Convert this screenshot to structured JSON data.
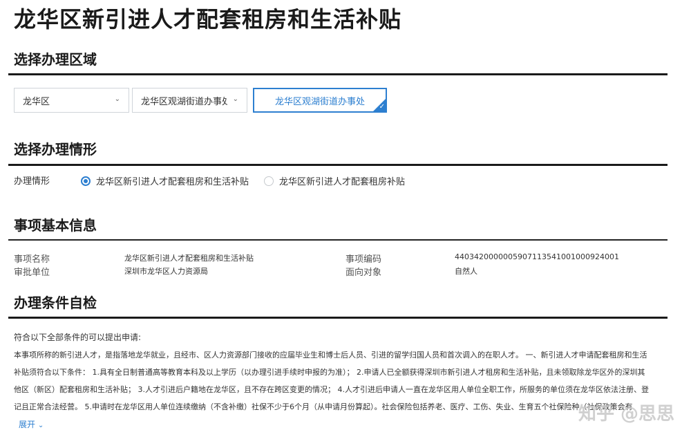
{
  "page": {
    "title": "龙华区新引进人才配套租房和生活补贴"
  },
  "region_section": {
    "title": "选择办理区域",
    "district_select": "龙华区",
    "street_select": "龙华区观湖街道办事处",
    "office_card": "龙华区观湖街道办事处"
  },
  "situation_section": {
    "title": "选择办理情形",
    "label": "办理情形",
    "options": [
      {
        "label": "龙华区新引进人才配套租房和生活补贴",
        "selected": true
      },
      {
        "label": "龙华区新引进人才配套租房补贴",
        "selected": false
      }
    ]
  },
  "info_section": {
    "title": "事项基本信息",
    "rows": [
      {
        "label": "事项名称",
        "value": "龙华区新引进人才配套租房和生活补贴",
        "label2": "事项编码",
        "value2": "440342000000590711354100100092400​1"
      },
      {
        "label": "审批单位",
        "value": "深圳市龙华区人力资源局",
        "label2": "面向对象",
        "value2": "自然人"
      }
    ]
  },
  "conditions_section": {
    "title": "办理条件自检",
    "lead": "符合以下全部条件的可以提出申请:",
    "lines": [
      "本事项所称的新引进人才，是指落地龙华就业，且经市、区人力资源部门接收的应届毕业生和博士后人员、引进的留学归国人员和首次调入的在职人才。 一、新引进人才申请配套租房和生活",
      "补贴须符合以下条件： 1.具有全日制普通高等教育本科及以上学历（以办理引进手续时申报的为准）； 2.申请人已全额获得深圳市新引进人才租房和生活补贴，且未领取除龙华区外的深圳其",
      "他区（新区）配套租房和生活补贴； 3.人才引进后户籍地在龙华区，且不存在跨区变更的情况； 4.人才引进后申请人一直在龙华区用人单位全职工作，所服务的单位须在龙华区依法注册、登",
      "记且正常合法经营。 5.申请时在龙华区用人单位连续缴纳（不含补缴）社保不少于6个月（从申请月份算起）。社会保险包括养老、医疗、工伤、失业、生育五个社保险种（社保政策会有"
    ],
    "expand_label": "展开"
  },
  "watermark": "知乎 @思思",
  "colors": {
    "accent": "#2d7fd0",
    "title": "#1a1a1a"
  }
}
